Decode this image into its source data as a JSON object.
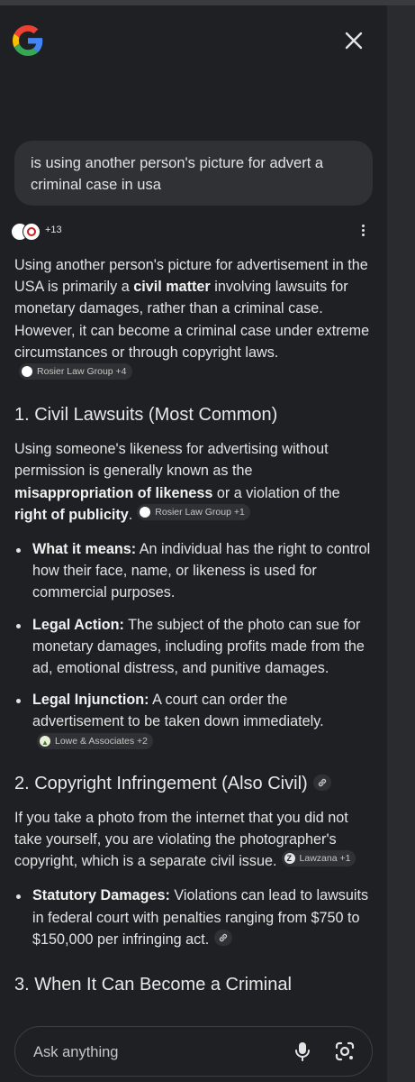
{
  "header": {
    "logo_icon": "google-g-icon",
    "close_icon": "close-icon"
  },
  "query": {
    "text": "is using another person's picture for advert a criminal case in usa"
  },
  "sources": {
    "count_label": "+13",
    "more_icon": "more-vert-icon"
  },
  "answer": {
    "intro": {
      "t1": "Using another person's picture for advertisement in the USA is primarily a ",
      "b1": "civil matter",
      "t2": " involving lawsuits for monetary damages, rather than a criminal case. However, it can become a criminal case under extreme circumstances or through copyright laws.",
      "chip": "Rosier Law Group +4"
    },
    "section1": {
      "heading": "1. Civil Lawsuits (Most Common)",
      "para": {
        "t1": "Using someone's likeness for advertising without permission is generally known as the ",
        "b1": "misappropriation of likeness",
        "t2": " or a violation of the ",
        "b2": "right of publicity",
        "t3": ".",
        "chip": "Rosier Law Group +1"
      },
      "bullets": [
        {
          "bold": "What it means:",
          "text": " An individual has the right to control how their face, name, or likeness is used for commercial purposes."
        },
        {
          "bold": "Legal Action:",
          "text": " The subject of the photo can sue for monetary damages, including profits made from the ad, emotional distress, and punitive damages."
        },
        {
          "bold": "Legal Injunction:",
          "text": " A court can order the advertisement to be taken down immediately.",
          "chip": "Lowe & Associates +2"
        }
      ]
    },
    "section2": {
      "heading": "2. Copyright Infringement (Also Civil)",
      "para": {
        "text": "If you take a photo from the internet that you did not take yourself, you are violating the photographer's copyright, which is a separate civil issue.",
        "chip": "Lawzana +1"
      },
      "bullets": [
        {
          "bold": "Statutory Damages:",
          "text": " Violations can lead to lawsuits in federal court with penalties ranging from $750 to $150,000 per infringing act."
        }
      ]
    },
    "section3": {
      "heading": "3. When It Can Become a Criminal"
    }
  },
  "input": {
    "placeholder": "Ask anything",
    "mic_icon": "microphone-icon",
    "lens_icon": "google-lens-icon"
  },
  "colors": {
    "background": "#1f2023",
    "surface": "#303134",
    "text": "#e3e3e3"
  }
}
